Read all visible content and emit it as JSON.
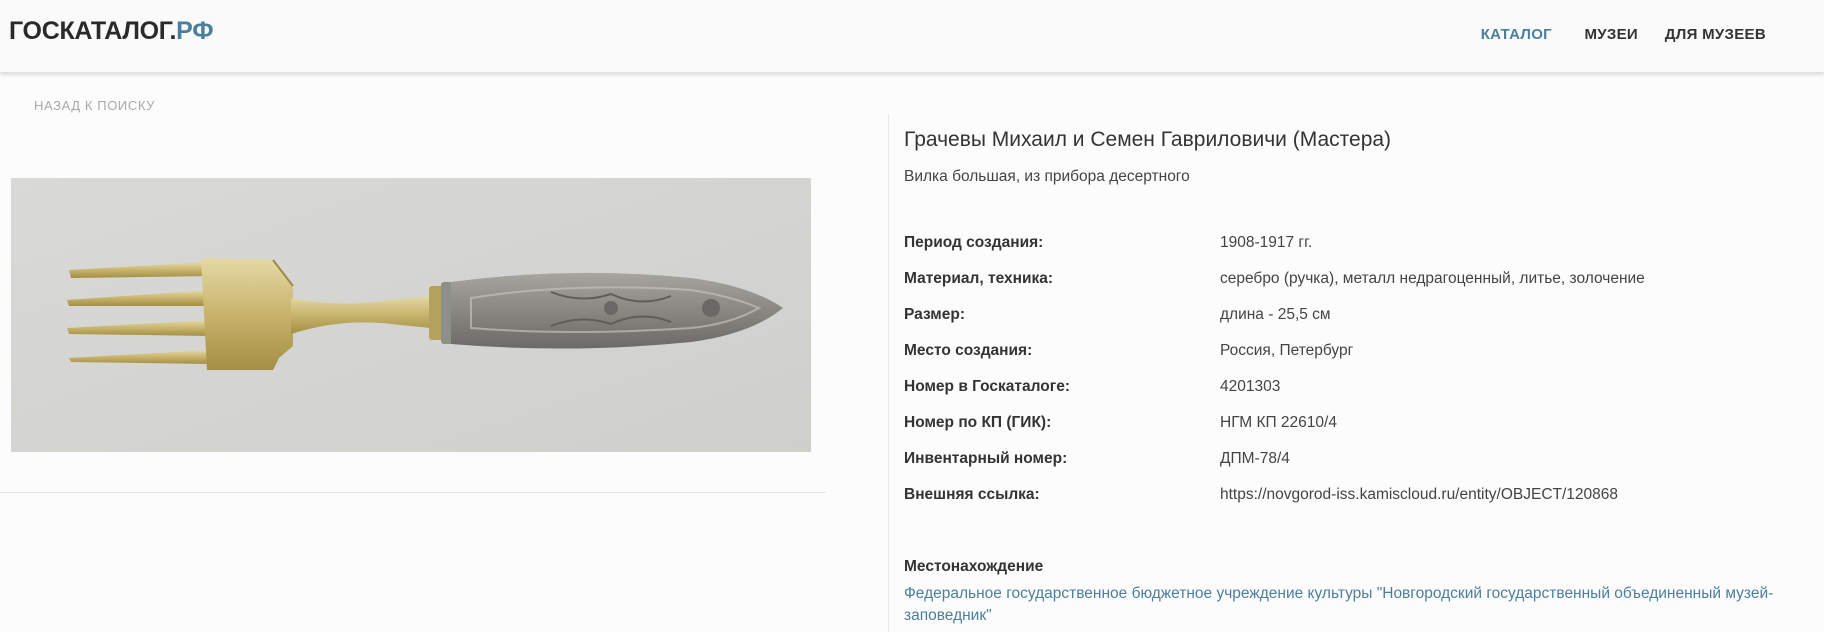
{
  "header": {
    "logo_main": "ГОСКАТАЛОГ.",
    "logo_accent": "РФ",
    "nav": [
      {
        "label": "КАТАЛОГ",
        "active": true
      },
      {
        "label": "МУЗЕИ",
        "active": false
      },
      {
        "label": "ДЛЯ МУЗЕЕВ",
        "active": false
      }
    ]
  },
  "back_link": "НАЗАД К ПОИСКУ",
  "photo": {
    "icon": "fork-image",
    "background": "#d6d6d4"
  },
  "object": {
    "title": "Грачевы Михаил и Семен Гавриловичи (Мастера)",
    "subtitle": "Вилка большая, из прибора десертного",
    "properties": [
      {
        "label": "Период создания:",
        "value": "1908-1917 гг."
      },
      {
        "label": "Материал, техника:",
        "value": "серебро (ручка), металл недрагоценный, литье, золочение"
      },
      {
        "label": "Размер:",
        "value": "длина - 25,5 см"
      },
      {
        "label": "Место создания:",
        "value": "Россия, Петербург"
      },
      {
        "label": "Номер в Госкаталоге:",
        "value": "4201303"
      },
      {
        "label": "Номер по КП (ГИК):",
        "value": "НГМ КП 22610/4"
      },
      {
        "label": "Инвентарный номер:",
        "value": "ДПМ-78/4"
      },
      {
        "label": "Внешняя ссылка:",
        "value": "https://novgorod-iss.kamiscloud.ru/entity/OBJECT/120868"
      }
    ],
    "location_heading": "Местонахождение",
    "location_link": "Федеральное государственное бюджетное учреждение культуры \"Новгородский государственный объединенный музей-заповедник\""
  },
  "colors": {
    "accent": "#4b7f9d",
    "text": "#333333",
    "muted": "#a9a9a9"
  }
}
